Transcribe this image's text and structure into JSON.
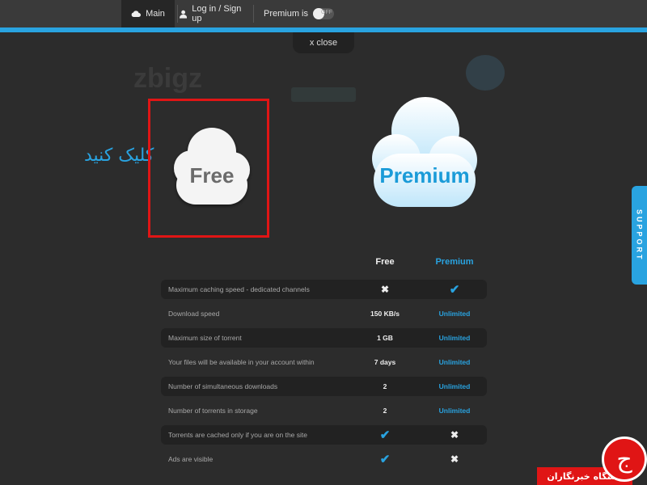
{
  "nav": {
    "main_label": "Main",
    "login_label": "Log in / Sign up",
    "premium_label": "Premium is",
    "toggle_text": "OFF"
  },
  "close_label": "x close",
  "bg_brand": "zbigz",
  "annotation": {
    "hint_text": "کلیک کنید",
    "box_color": "#e01515"
  },
  "plans": {
    "free_label": "Free",
    "premium_label": "Premium"
  },
  "support_label": "SUPPORT",
  "table": {
    "headers": {
      "free": "Free",
      "premium": "Premium"
    },
    "rows": [
      {
        "label": "Maximum caching speed - dedicated channels",
        "free": "✖",
        "premium": "✔"
      },
      {
        "label": "Download speed",
        "free": "150 KB/s",
        "premium": "Unlimited"
      },
      {
        "label": "Maximum size of torrent",
        "free": "1 GB",
        "premium": "Unlimited"
      },
      {
        "label": "Your files will be available in your account within",
        "free": "7 days",
        "premium": "Unlimited"
      },
      {
        "label": "Number of simultaneous downloads",
        "free": "2",
        "premium": "Unlimited"
      },
      {
        "label": "Number of torrents in storage",
        "free": "2",
        "premium": "Unlimited"
      },
      {
        "label": "Torrents are cached only if you are on the site",
        "free": "✔",
        "premium": "✖"
      },
      {
        "label": "Ads are visible",
        "free": "✔",
        "premium": "✖"
      }
    ]
  },
  "watermark": {
    "text": "باشگاه خبرنگاران",
    "logo_char": "ج"
  },
  "colors": {
    "accent": "#29a3e0",
    "background": "#2c2c2c",
    "highlight": "#e01515"
  }
}
